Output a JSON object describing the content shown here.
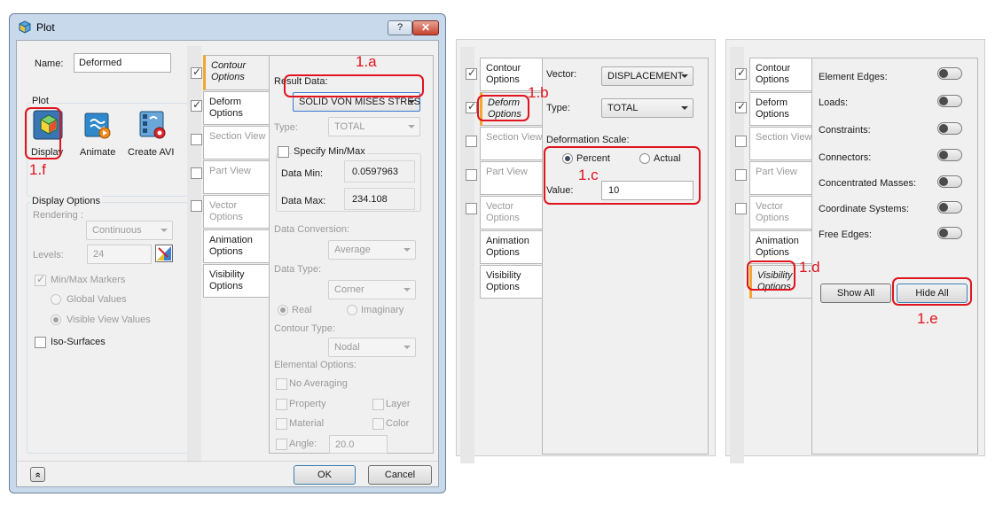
{
  "dialog": {
    "title": "Plot",
    "help_label": "?",
    "close_label": "✕",
    "name_label": "Name:",
    "name_value": "Deformed",
    "plot_group": "Plot",
    "tools": [
      {
        "label": "Display"
      },
      {
        "label": "Animate"
      },
      {
        "label": "Create AVI"
      }
    ],
    "display_options": {
      "title": "Display Options",
      "rendering_label": "Rendering :",
      "rendering_value": "Continuous",
      "levels_label": "Levels:",
      "levels_value": "24",
      "minmax_label": "Min/Max Markers",
      "global_values": "Global Values",
      "visible_view_values": "Visible View Values",
      "iso_surfaces": "Iso-Surfaces"
    },
    "ok_label": "OK",
    "cancel_label": "Cancel",
    "collapse_label": "«"
  },
  "tabs": {
    "contour": "Contour Options",
    "deform": "Deform Options",
    "section": "Section View",
    "part": "Part View",
    "vector": "Vector Options",
    "animation": "Animation Options",
    "visibility": "Visibility Options"
  },
  "contour_panel": {
    "result_data_label": "Result Data:",
    "result_data_value": "SOLID VON MISES STRES",
    "type_label": "Type:",
    "type_value": "TOTAL",
    "specify_minmax": "Specify Min/Max",
    "data_min_label": "Data Min:",
    "data_min_value": "0.0597963",
    "data_max_label": "Data Max:",
    "data_max_value": "234.108",
    "data_conversion_label": "Data Conversion:",
    "data_conversion_value": "Average",
    "data_type_label": "Data Type:",
    "data_type_value": "Corner",
    "real": "Real",
    "imaginary": "Imaginary",
    "contour_type_label": "Contour Type:",
    "contour_type_value": "Nodal",
    "elemental_options_label": "Elemental Options:",
    "no_averaging": "No Averaging",
    "property": "Property",
    "layer": "Layer",
    "material": "Material",
    "color": "Color",
    "angle_label": "Angle:",
    "angle_value": "20.0"
  },
  "deform_panel": {
    "vector_label": "Vector:",
    "vector_value": "DISPLACEMENT",
    "type_label": "Type:",
    "type_value": "TOTAL",
    "deformation_scale_label": "Deformation Scale:",
    "percent": "Percent",
    "actual": "Actual",
    "value_label": "Value:",
    "value": "10"
  },
  "visibility_panel": {
    "items": [
      "Element Edges:",
      "Loads:",
      "Constraints:",
      "Connectors:",
      "Concentrated Masses:",
      "Coordinate Systems:",
      "Free Edges:"
    ],
    "show_all": "Show All",
    "hide_all": "Hide All"
  },
  "annotations": {
    "a": "1.a",
    "b": "1.b",
    "c": "1.c",
    "d": "1.d",
    "e": "1.e",
    "f": "1.f"
  },
  "colors": {
    "accent_red": "#e0141e",
    "title_bar": "#c8d9ec",
    "active_tab_marker": "#f0a830"
  }
}
